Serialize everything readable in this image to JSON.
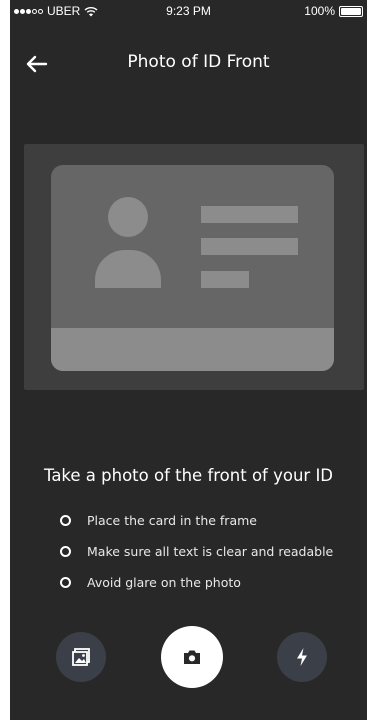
{
  "status_bar": {
    "carrier": "UBER",
    "time": "9:23 PM",
    "battery": "100%"
  },
  "header": {
    "title": "Photo of ID Front",
    "back_icon": "arrow-left-icon"
  },
  "id_card_placeholder": {
    "avatar_icon": "person-icon"
  },
  "instructions": {
    "title": "Take a photo of the front of your ID",
    "items": [
      "Place the card in the frame",
      "Make sure all text is clear and readable",
      "Avoid glare on the photo"
    ]
  },
  "controls": {
    "gallery_icon": "gallery-icon",
    "shutter_icon": "camera-icon",
    "flash_icon": "flash-icon"
  },
  "colors": {
    "background": "#282828",
    "frame": "#3e3e3e",
    "card": "#666666",
    "card_detail": "#8c8c8c",
    "secondary_button": "#3b3f47",
    "shutter": "#ffffff"
  }
}
